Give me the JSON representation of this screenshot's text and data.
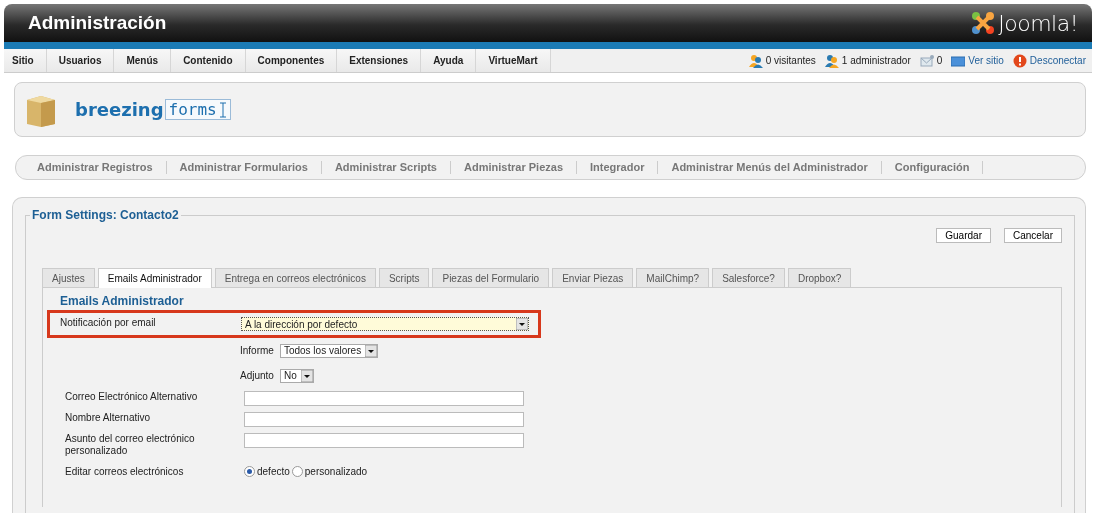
{
  "header": {
    "title": "Administración",
    "logo": "Joomla!"
  },
  "menu": [
    {
      "label": "Sitio"
    },
    {
      "label": "Usuarios"
    },
    {
      "label": "Menús"
    },
    {
      "label": "Contenido"
    },
    {
      "label": "Componentes"
    },
    {
      "label": "Extensiones"
    },
    {
      "label": "Ayuda"
    },
    {
      "label": "VirtueMart"
    }
  ],
  "status": [
    {
      "kind": "visitors",
      "text": "0 visitantes"
    },
    {
      "kind": "admins",
      "text": "1 administrador"
    },
    {
      "kind": "messages",
      "text": "0"
    },
    {
      "kind": "site",
      "text": "Ver sitio"
    },
    {
      "kind": "logout",
      "text": "Desconectar"
    }
  ],
  "brand": {
    "bold": "breezing",
    "mono": "forms"
  },
  "subnav": [
    {
      "label": "Administrar Registros"
    },
    {
      "label": "Administrar Formularios"
    },
    {
      "label": "Administrar Scripts"
    },
    {
      "label": "Administrar Piezas"
    },
    {
      "label": "Integrador"
    },
    {
      "label": "Administrar Menús del Administrador"
    },
    {
      "label": "Configuración"
    }
  ],
  "settings": {
    "legend": "Form Settings: Contacto2",
    "buttons": [
      "Guardar",
      "Cancelar"
    ],
    "tabs": [
      {
        "label": "Ajustes",
        "selected": false
      },
      {
        "label": "Emails Administrador",
        "selected": true
      },
      {
        "label": "Entrega en correos electrónicos",
        "selected": false
      },
      {
        "label": "Scripts",
        "selected": false
      },
      {
        "label": "Piezas del Formulario",
        "selected": false
      },
      {
        "label": "Enviar Piezas",
        "selected": false
      },
      {
        "label": "MailChimp?",
        "selected": false
      },
      {
        "label": "Salesforce?",
        "selected": false
      },
      {
        "label": "Dropbox?",
        "selected": false
      }
    ],
    "section_title": "Emails Administrador",
    "rows": [
      {
        "kind": "select",
        "label": "Notificación por email",
        "value": "A la dirección por defecto",
        "highlighted": true
      },
      {
        "kind": "subselect",
        "label": "Informe",
        "value": "Todos los valores"
      },
      {
        "kind": "subselect",
        "label": "Adjunto",
        "value": "No"
      },
      {
        "kind": "text",
        "label": "Correo Electrónico Alternativo"
      },
      {
        "kind": "text",
        "label": "Nombre Alternativo"
      },
      {
        "kind": "text",
        "label": "Asunto del correo electrónico personalizado"
      },
      {
        "kind": "radio",
        "label": "Editar correos electrónicos",
        "options": [
          {
            "label": "defecto",
            "selected": true
          },
          {
            "label": "personalizado",
            "selected": false
          }
        ]
      }
    ]
  }
}
